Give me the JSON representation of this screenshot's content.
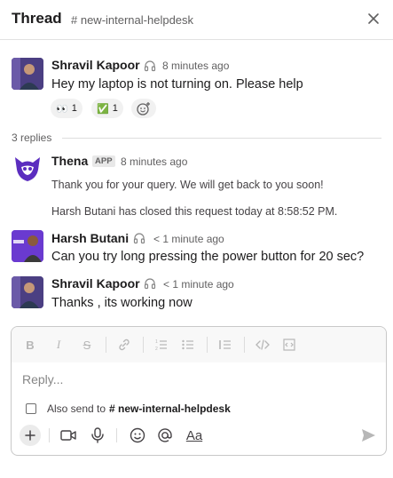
{
  "header": {
    "title": "Thread",
    "channel": "# new-internal-helpdesk"
  },
  "messages": [
    {
      "author": "Shravil Kapoor",
      "time": "8 minutes ago",
      "text": "Hey my laptop is not turning on. Please help",
      "reactions": [
        {
          "emoji": "👀",
          "count": "1"
        },
        {
          "emoji": "✅",
          "count": "1"
        }
      ]
    }
  ],
  "replies_label": "3 replies",
  "replies": [
    {
      "author": "Thena",
      "badge": "APP",
      "time": "8 minutes ago",
      "text": "Thank you for your query. We will get back to you soon!",
      "note": "Harsh Butani has closed this request today at 8:58:52 PM."
    },
    {
      "author": "Harsh Butani",
      "time": "< 1 minute ago",
      "text": "Can you try long pressing the power button for 20 sec?"
    },
    {
      "author": "Shravil Kapoor",
      "time": "< 1 minute ago",
      "text": "Thanks , its working now"
    }
  ],
  "composer": {
    "placeholder": "Reply...",
    "also_send_prefix": "Also send to",
    "also_send_channel": "# new-internal-helpdesk",
    "toolbar": [
      "B",
      "I",
      "S"
    ],
    "format_label": "Aa"
  },
  "colors": {
    "thena_purple": "#5b2dbf",
    "check_green": "#2bac76",
    "badge_bg": "#e8e8e8"
  }
}
